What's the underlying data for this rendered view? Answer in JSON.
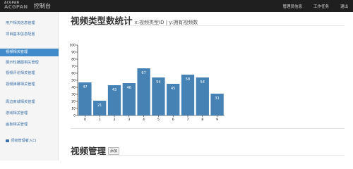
{
  "header": {
    "logo_top": "ACGPAN",
    "logo_bottom": "ACGPAN",
    "title": "控制台",
    "nav": [
      "管理员信息",
      "工作任务",
      "退出"
    ]
  },
  "sidebar": {
    "items": [
      {
        "label": "用户相关信息管理",
        "active": false
      },
      {
        "label": "项目基本信息配置",
        "active": false
      },
      {
        "label": "视频相关管理",
        "active": true
      },
      {
        "label": "展示轮播图相关管理",
        "active": false
      },
      {
        "label": "视频评论相关管理",
        "active": false
      },
      {
        "label": "视频弹幕相关管理",
        "active": false
      },
      {
        "label": "周边商城相关管理",
        "active": false
      },
      {
        "label": "游戏相关管理",
        "active": false
      },
      {
        "label": "画板相关管理",
        "active": false
      }
    ],
    "footer_label": "顶级管理者入口"
  },
  "main": {
    "title": "视频类型数统计",
    "subtitle": "x:视频类型ID | y:拥有视频数",
    "section2_title": "视频管理",
    "add_label": "添加"
  },
  "chart_data": {
    "type": "bar",
    "categories": [
      "0",
      "1",
      "2",
      "3",
      "4",
      "5",
      "6",
      "7",
      "8",
      "9"
    ],
    "values": [
      47,
      21,
      43,
      46,
      67,
      54,
      45,
      58,
      54,
      31
    ],
    "ylim": [
      0,
      100
    ],
    "yticks": [
      0,
      10,
      20,
      30,
      40,
      50,
      60,
      70,
      80,
      90,
      100
    ],
    "bar_color": "#4682b4",
    "title": "",
    "xlabel": "",
    "ylabel": ""
  }
}
